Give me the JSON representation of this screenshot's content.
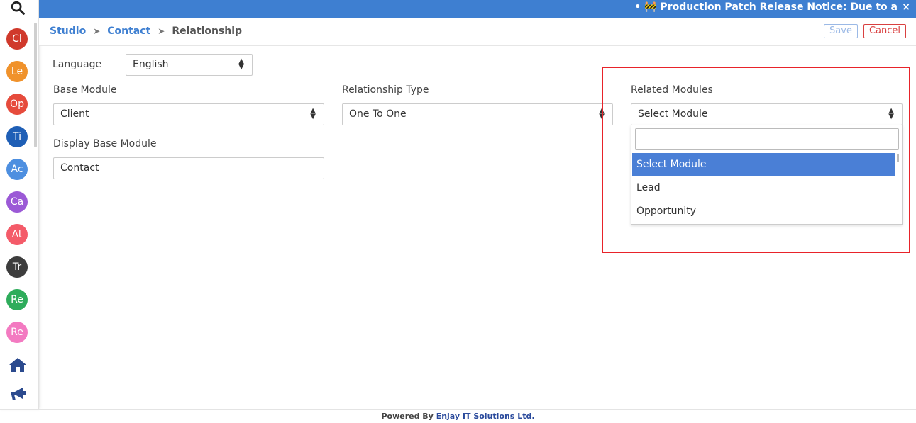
{
  "topbar": {
    "notice": "• 🚧 Production Patch Release Notice: Due to a",
    "close": "×"
  },
  "sidebar": {
    "avatars": [
      {
        "label": "Cl",
        "color": "#d0392b"
      },
      {
        "label": "Le",
        "color": "#f0922b"
      },
      {
        "label": "Op",
        "color": "#e64b3c"
      },
      {
        "label": "Ti",
        "color": "#1f5fb6"
      },
      {
        "label": "Ac",
        "color": "#4d8fe0"
      },
      {
        "label": "Ca",
        "color": "#9b59d6"
      },
      {
        "label": "At",
        "color": "#f45b69"
      },
      {
        "label": "Tr",
        "color": "#3d3d3d"
      },
      {
        "label": "Re",
        "color": "#2eac5b"
      },
      {
        "label": "Re",
        "color": "#f37ac1"
      }
    ]
  },
  "breadcrumb": {
    "studio": "Studio",
    "contact": "Contact",
    "current": "Relationship",
    "sep": "➤"
  },
  "actions": {
    "save": "Save",
    "cancel": "Cancel"
  },
  "form": {
    "language_label": "Language",
    "language_value": "English",
    "base_module_label": "Base Module",
    "base_module_value": "Client",
    "display_base_label": "Display Base Module",
    "display_base_value": "Contact",
    "relationship_type_label": "Relationship Type",
    "relationship_type_value": "One To One",
    "related_modules_label": "Related Modules",
    "related_modules_value": "Select Module",
    "related_options": [
      "Select Module",
      "Lead",
      "Opportunity"
    ]
  },
  "footer": {
    "prefix": "Powered By ",
    "brand": "Enjay IT Solutions Ltd."
  },
  "colors": {
    "accent": "#3e7fd1",
    "highlight": "#e8232a",
    "active_option": "#4a7fd6"
  }
}
